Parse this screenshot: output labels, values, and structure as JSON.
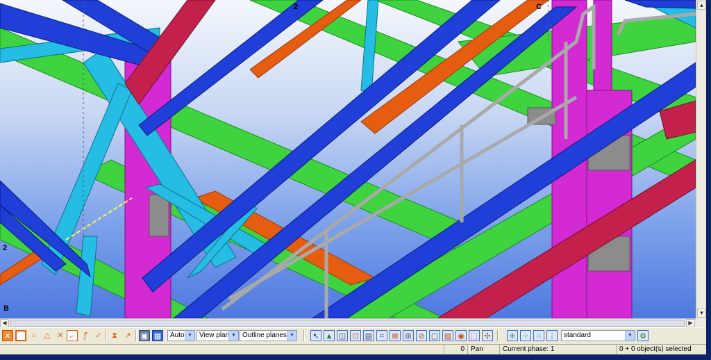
{
  "viewport": {
    "grid_labels": {
      "top_2": "2",
      "top_c": "C",
      "left_2": "2",
      "left_b": "B"
    },
    "colors": {
      "background_top": "#f4f7fc",
      "background_bottom": "#4e78e0",
      "beam_blue": "#1f3fd8",
      "beam_green": "#39d43c",
      "beam_orange": "#e05a0c",
      "column_magenta": "#d42ad4",
      "beam_red": "#c0204a",
      "brace_cyan": "#22b8e0",
      "railing_gray": "#a8a8a8"
    }
  },
  "toolbar": {
    "left_icons": [
      "snap-endpoint-icon",
      "snap-orange-square-icon",
      "snap-circle-icon",
      "snap-triangle-icon",
      "snap-cross-icon",
      "snap-corner-icon",
      "snap-midpoint-icon",
      "snap-check-icon",
      "snap-hourglass-icon",
      "snap-arrow-icon",
      "view-3d-icon",
      "view-grid-icon"
    ],
    "select_auto": "Auto",
    "select_plane": "View plane",
    "select_outline": "Outline planes",
    "right_icons": [
      "select-pointer-icon",
      "select-part-icon",
      "select-assembly-icon",
      "select-bolt-icon",
      "select-weld-icon",
      "select-grid-icon",
      "select-connection-icon",
      "select-reinforcement-icon",
      "select-surface-icon",
      "select-component-icon",
      "select-cut-icon",
      "select-object-icon",
      "select-all-icon",
      "select-group-icon",
      "select-filter-icon",
      "select-view-icon"
    ],
    "filter_value": "standard"
  },
  "status": {
    "count": "0",
    "mode": "Pan",
    "phase": "Current phase: 1",
    "selection": "0 + 0 object(s) selected"
  }
}
